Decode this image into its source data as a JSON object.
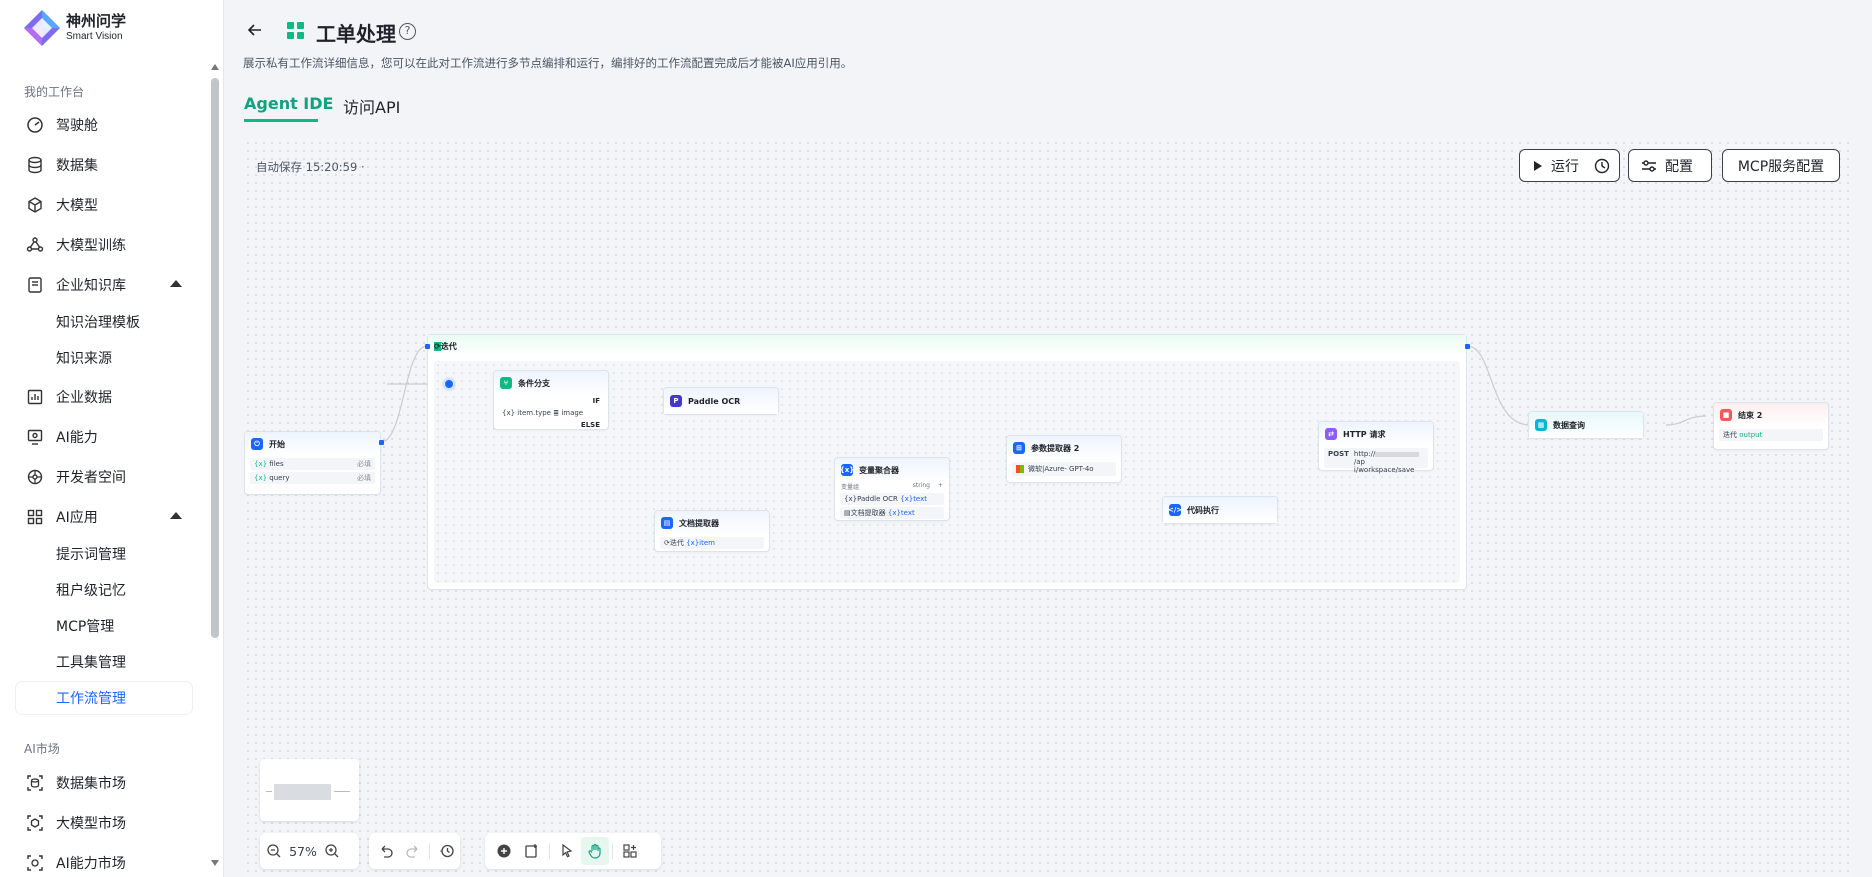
{
  "brand": {
    "name_cn": "神州问学",
    "name_en": "Smart Vision"
  },
  "sidebar": {
    "section_workspace": "我的工作台",
    "items": [
      {
        "label": "驾驶舱",
        "icon": "dashboard-icon"
      },
      {
        "label": "数据集",
        "icon": "database-icon"
      },
      {
        "label": "大模型",
        "icon": "cube-icon"
      },
      {
        "label": "大模型训练",
        "icon": "training-icon"
      },
      {
        "label": "企业知识库",
        "icon": "knowledge-icon",
        "expanded": true
      },
      {
        "label": "企业数据",
        "icon": "chart-icon"
      },
      {
        "label": "AI能力",
        "icon": "ai-capability-icon"
      },
      {
        "label": "开发者空间",
        "icon": "developer-icon"
      },
      {
        "label": "AI应用",
        "icon": "apps-icon",
        "expanded": true
      }
    ],
    "knowledge_sub": [
      "知识治理模板",
      "知识来源"
    ],
    "apps_sub": [
      "提示词管理",
      "租户级记忆",
      "MCP管理",
      "工具集管理",
      "工作流管理"
    ],
    "active_sub": "工作流管理",
    "section_market": "AI市场",
    "market_items": [
      {
        "label": "数据集市场",
        "icon": "dataset-market-icon"
      },
      {
        "label": "大模型市场",
        "icon": "model-market-icon"
      },
      {
        "label": "AI能力市场",
        "icon": "ai-market-icon"
      }
    ]
  },
  "header": {
    "title": "工单处理",
    "description": "展示私有工作流详细信息，您可以在此对工作流进行多节点编排和运行，编排好的工作流配置完成后才能被AI应用引用。"
  },
  "tabs": [
    {
      "label": "Agent IDE",
      "active": true
    },
    {
      "label": "访问API",
      "active": false
    }
  ],
  "canvas": {
    "autosave": "自动保存 15:20:59 ·",
    "run_label": "运行",
    "config_label": "配置",
    "mcp_label": "MCP服务配置",
    "zoom": "57%"
  },
  "colors": {
    "accent_green": "#10b981",
    "active_blue": "#1a66ff",
    "wire": "#c8cdd4"
  },
  "nodes": {
    "start": {
      "title": "开始",
      "fields": [
        {
          "name": "files",
          "tag": "必填"
        },
        {
          "name": "query",
          "tag": "必填"
        }
      ]
    },
    "iteration": {
      "title": "迭代"
    },
    "branch": {
      "title": "条件分支",
      "if": "IF",
      "else": "ELSE",
      "cond_var": "item.type",
      "cond_val": "image"
    },
    "ocr": {
      "title": "Paddle OCR"
    },
    "doc_extract": {
      "title": "文档提取器",
      "src": "迭代",
      "var": "item"
    },
    "aggregator": {
      "title": "变量聚合器",
      "group": "变量组",
      "type": "string",
      "rows": [
        {
          "src": "Paddle OCR",
          "var": "text"
        },
        {
          "src": "文档提取器",
          "var": "text"
        }
      ]
    },
    "param_extract": {
      "title": "参数提取器 2",
      "model": "微软|Azure- GPT-4o"
    },
    "code": {
      "title": "代码执行"
    },
    "http": {
      "title": "HTTP 请求",
      "method": "POST",
      "url_a": "http://",
      "url_b": "/ap",
      "url_c": "i/workspace/save"
    },
    "db_query": {
      "title": "数据查询"
    },
    "end": {
      "title": "结束 2",
      "src": "迭代",
      "var": "output"
    }
  }
}
